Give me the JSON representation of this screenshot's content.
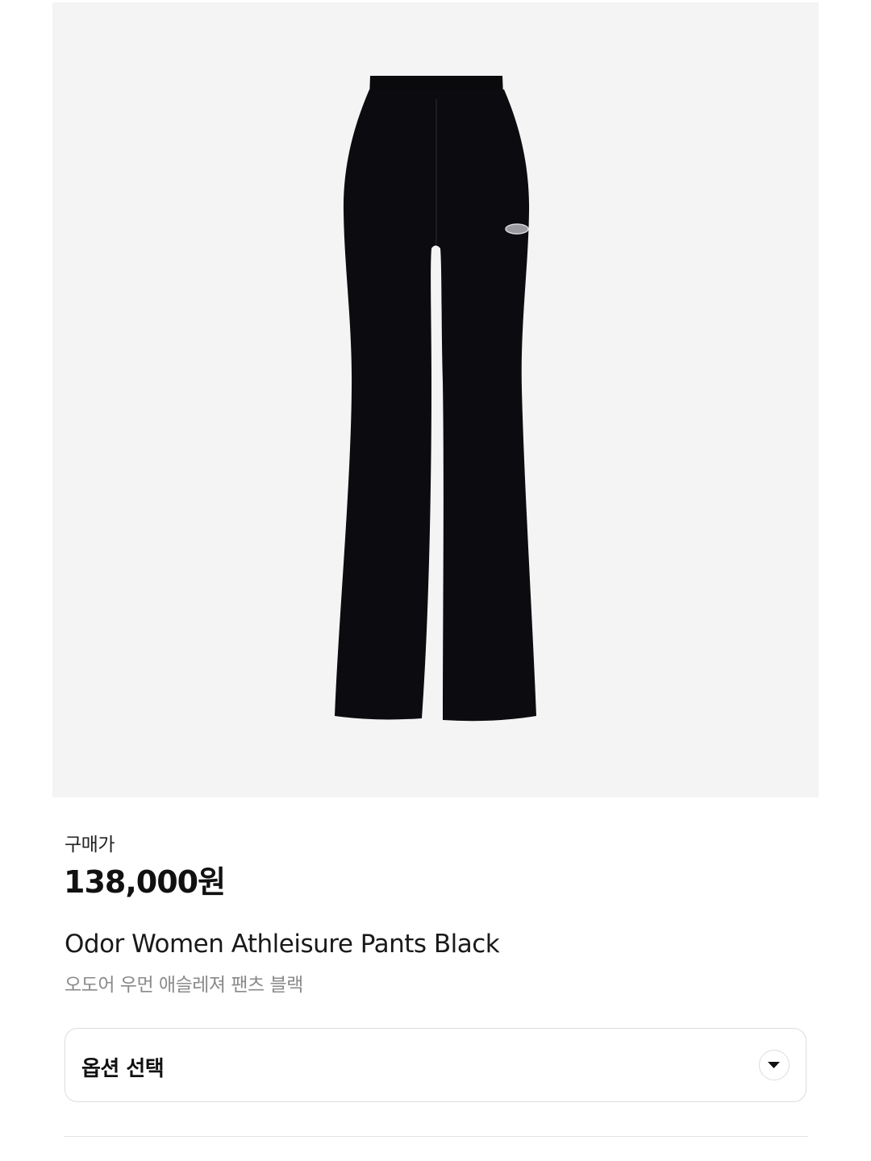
{
  "product": {
    "image_alt": "pants-product-image",
    "price_label": "구매가",
    "price": "138,000원",
    "name_en": "Odor Women Athleisure Pants Black",
    "name_ko": "오도어 우먼 애슬레져 팬츠 블랙"
  },
  "option": {
    "label": "옵션 선택",
    "icon": "chevron-down-icon"
  },
  "colors": {
    "image_bg": "#f4f4f4",
    "pants": "#0c0c10",
    "secondary_text": "#8a8a8a",
    "border": "#dcdcdc"
  }
}
